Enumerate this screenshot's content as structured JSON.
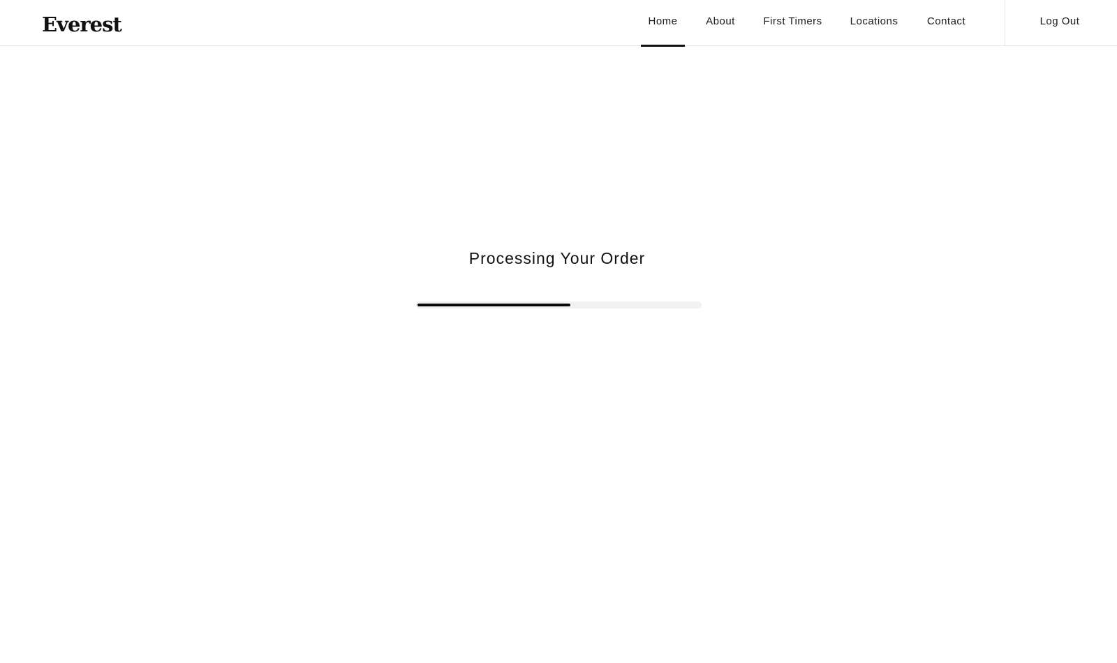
{
  "header": {
    "logo": "Everest",
    "nav": {
      "home": "Home",
      "about": "About",
      "first_timers": "First Timers",
      "locations": "Locations",
      "contact": "Contact",
      "log_out": "Log Out"
    },
    "active_item": "Home"
  },
  "main": {
    "title": "Processing Your Order",
    "progress": 0.54
  },
  "colors": {
    "text": "#111111",
    "progress_track": "#f1f1f1",
    "progress_fill": "#0a0a0a",
    "border": "#e6e6e6"
  }
}
